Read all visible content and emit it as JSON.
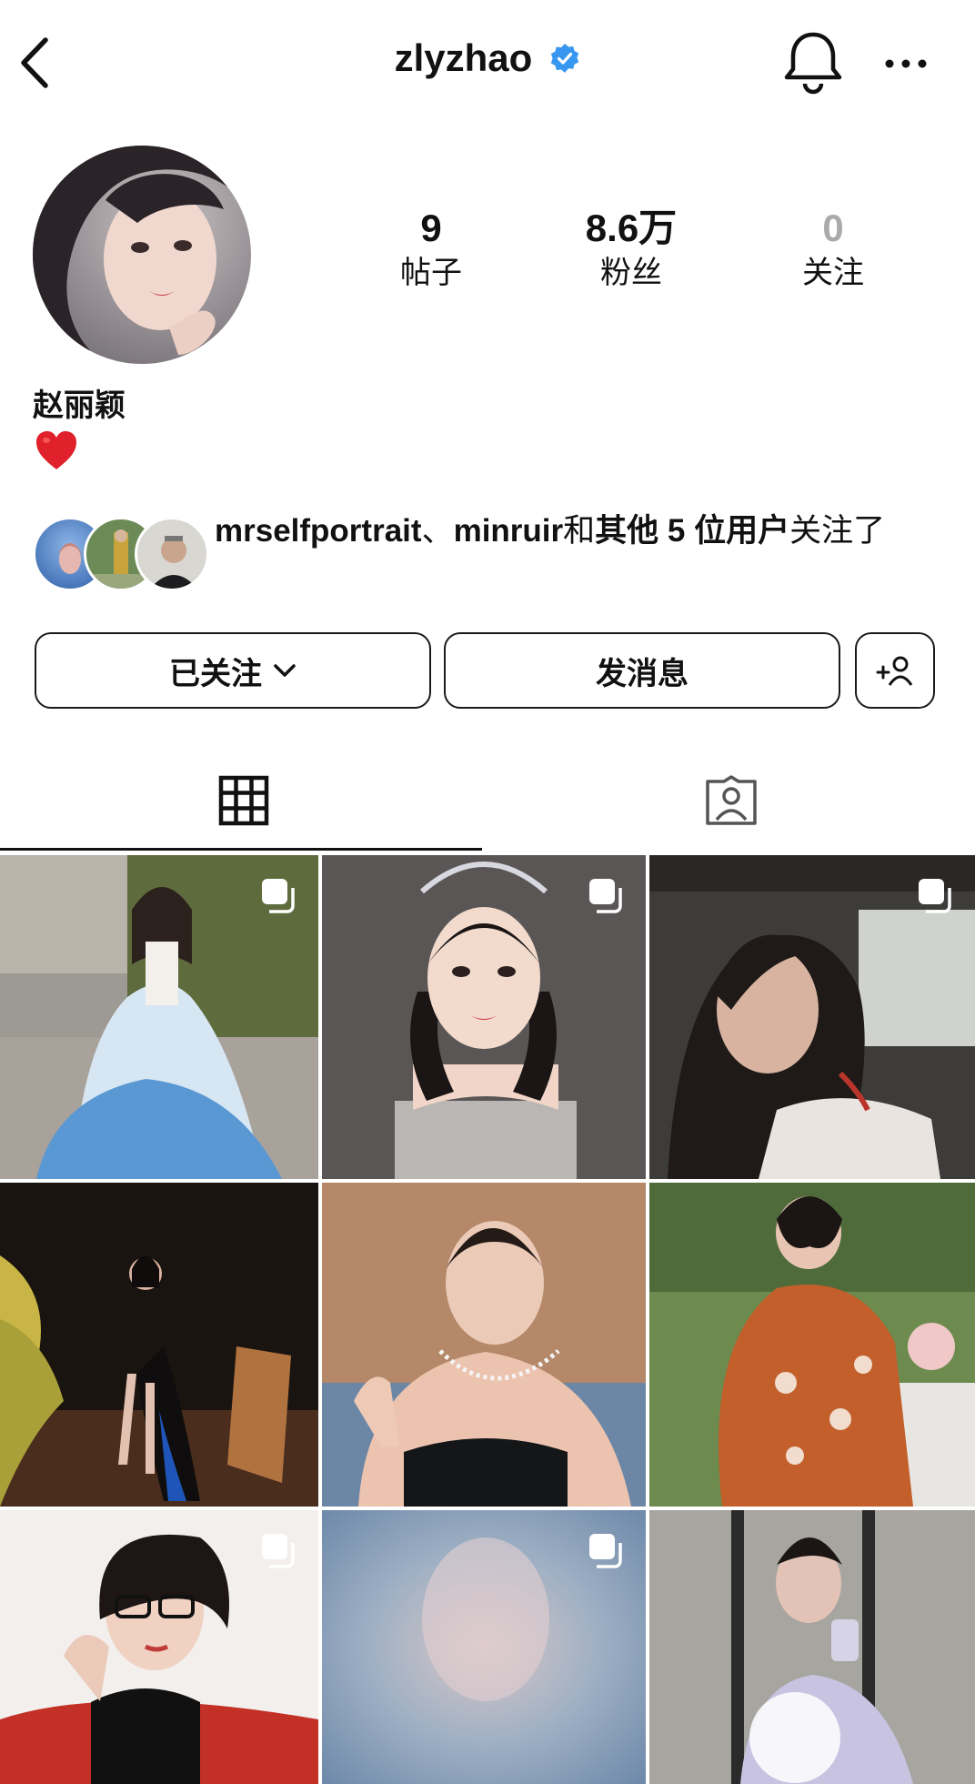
{
  "header": {
    "username": "zlyzhao",
    "icons": {
      "back": "chevron-left-icon",
      "verified": "verified-badge-icon",
      "bell": "bell-icon",
      "more": "more-horizontal-icon"
    }
  },
  "profile": {
    "stats": [
      {
        "value": "9",
        "label": "帖子"
      },
      {
        "value": "8.6万",
        "label": "粉丝"
      },
      {
        "value": "0",
        "label": "关注"
      }
    ],
    "display_name": "赵丽颖",
    "bio_emoji": "❤️"
  },
  "followed_by": {
    "user1": "mrselfportrait",
    "separator": "、",
    "user2": "minruir",
    "and": "和",
    "others": "其他 5 位用户",
    "suffix": "关注了"
  },
  "actions": {
    "following_label": "已关注",
    "message_label": "发消息",
    "add_person_icon": "add-person-icon"
  },
  "tabs": [
    {
      "name": "posts-grid",
      "icon": "grid-icon",
      "active": true
    },
    {
      "name": "tagged",
      "icon": "tagged-person-icon",
      "active": false
    }
  ],
  "posts": [
    {
      "multi": true,
      "desc": "white-blue gradient dress"
    },
    {
      "multi": true,
      "desc": "tiara portrait"
    },
    {
      "multi": true,
      "desc": "car selfie"
    },
    {
      "multi": false,
      "desc": "black gown chair"
    },
    {
      "multi": false,
      "desc": "diamond necklace"
    },
    {
      "multi": false,
      "desc": "orange embroidered robe"
    },
    {
      "multi": true,
      "desc": "glasses on red sofa"
    },
    {
      "multi": true,
      "desc": "blurred portrait"
    },
    {
      "multi": false,
      "desc": "mirror selfie sparkle"
    }
  ],
  "colors": {
    "verified": "#3897f0",
    "heart": "#e0202a",
    "text": "#111111",
    "muted": "#aaaaaa"
  }
}
